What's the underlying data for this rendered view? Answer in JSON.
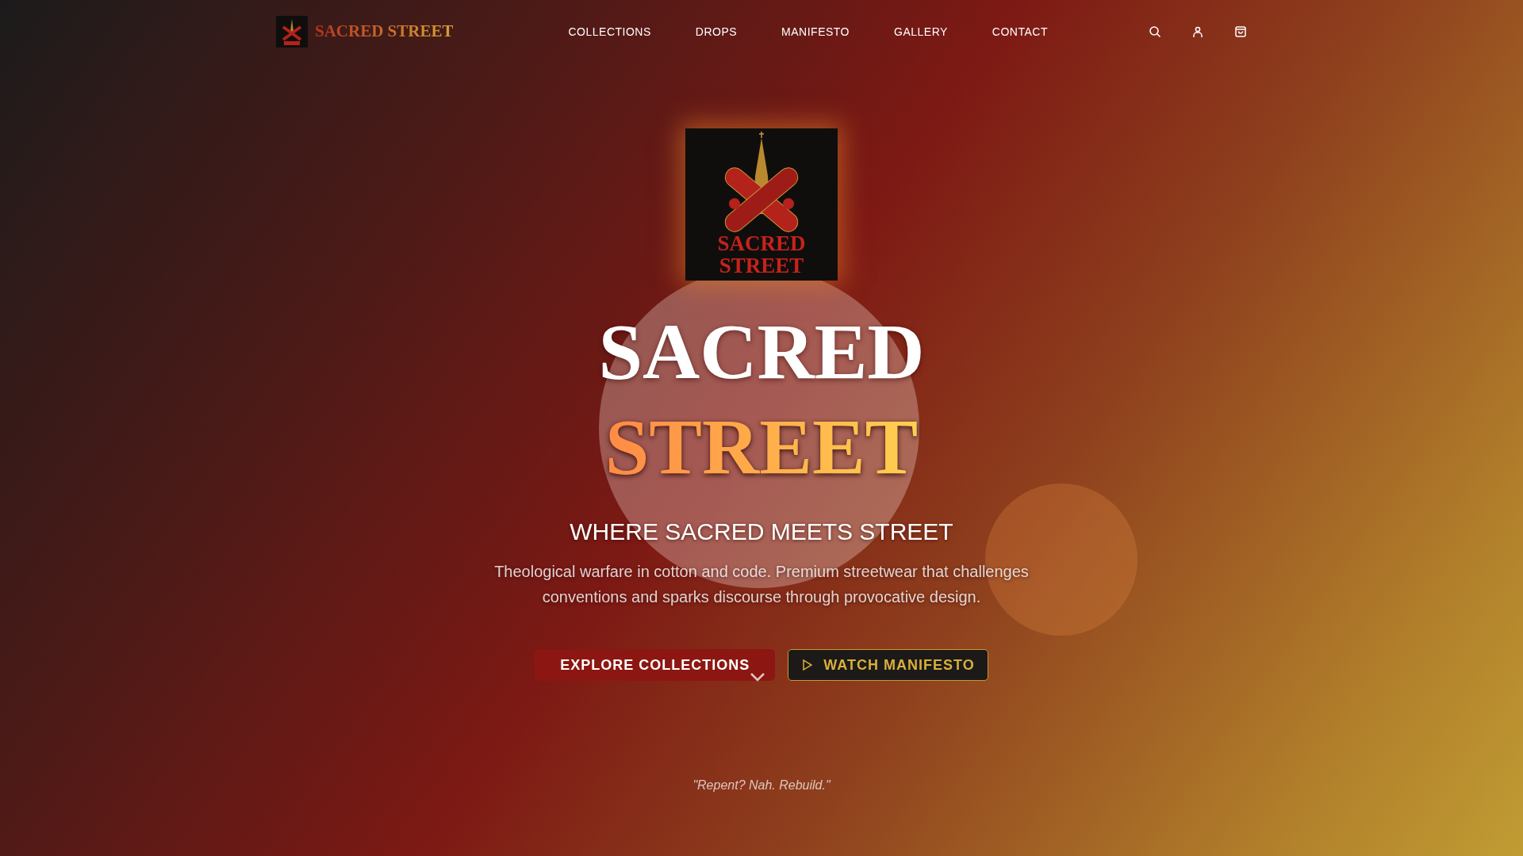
{
  "brand": {
    "name": "SACRED STREET"
  },
  "nav_links": [
    {
      "label": "COLLECTIONS"
    },
    {
      "label": "DROPS"
    },
    {
      "label": "MANIFESTO"
    },
    {
      "label": "GALLERY"
    },
    {
      "label": "CONTACT"
    }
  ],
  "hero": {
    "logo_text": [
      "SACRED",
      "STREET"
    ],
    "title": [
      {
        "text": "SACRED",
        "kind": "plain"
      },
      {
        "text": "STREET",
        "kind": "gradient"
      }
    ],
    "tagline": "WHERE SACRED MEETS STREET",
    "description": "Theological warfare in cotton and code. Premium streetwear that challenges conventions and sparks discourse through provocative design.",
    "buttons": [
      {
        "label": "EXPLORE COLLECTIONS",
        "kind": "primary"
      },
      {
        "label": "WATCH MANIFESTO",
        "kind": "outline"
      }
    ],
    "quote": "\"Repent? Nah. Rebuild.\""
  }
}
